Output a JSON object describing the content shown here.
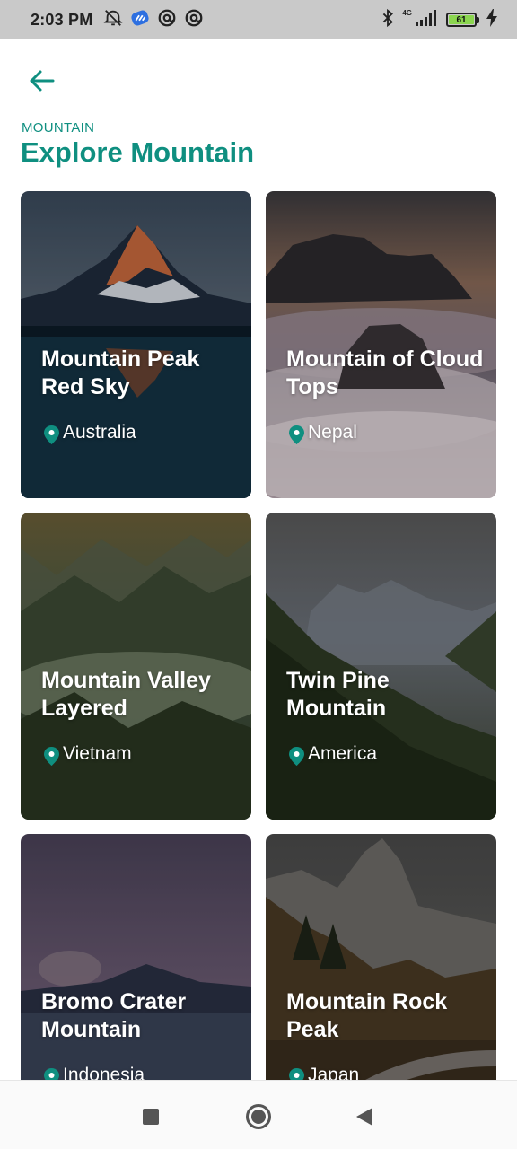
{
  "status_bar": {
    "time": "2:03 PM",
    "left_icons": [
      "alarm-off-icon",
      "app-badge-icon",
      "at-sign-icon",
      "at-sign-icon"
    ],
    "network_label": "4G",
    "battery_level": "61",
    "right_icons": [
      "bluetooth-icon",
      "signal-icon",
      "battery-icon",
      "charging-icon"
    ]
  },
  "header": {
    "back_icon": "arrow-left-icon",
    "eyebrow": "MOUNTAIN",
    "title": "Explore Mountain"
  },
  "colors": {
    "accent": "#0f8f80",
    "status_bar_bg": "#c9c9c9",
    "battery_fill": "#8bd64f"
  },
  "cards": [
    {
      "title": "Mountain Peak Red Sky",
      "location": "Australia"
    },
    {
      "title": "Mountain of Cloud Tops",
      "location": "Nepal"
    },
    {
      "title": "Mountain Valley Layered",
      "location": "Vietnam"
    },
    {
      "title": "Twin Pine Mountain",
      "location": "America"
    },
    {
      "title": "Bromo Crater Mountain",
      "location": "Indonesia"
    },
    {
      "title": "Mountain Rock Peak",
      "location": "Japan"
    }
  ],
  "nav_bar": {
    "icons": [
      "recents-square-icon",
      "home-circle-icon",
      "back-triangle-icon"
    ]
  }
}
